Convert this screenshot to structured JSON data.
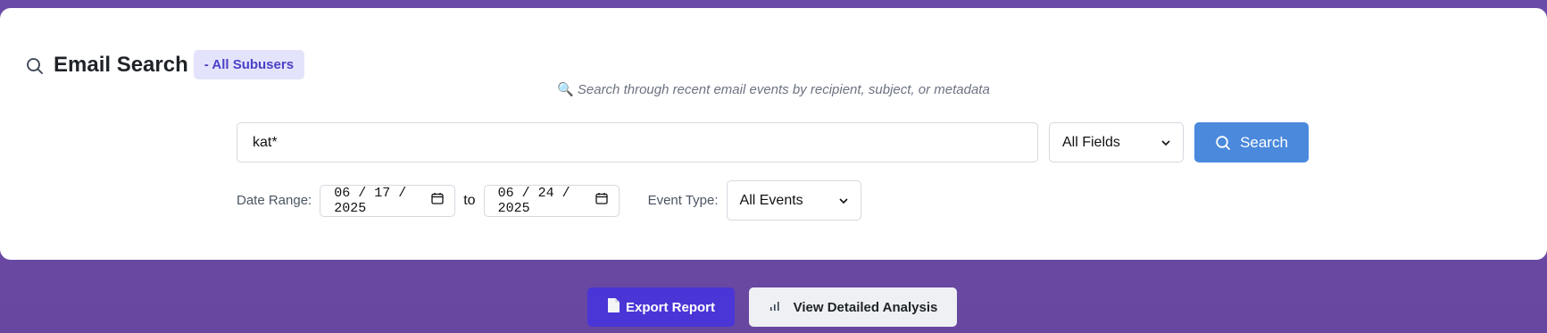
{
  "header": {
    "title": "Email Search",
    "badge": "- All Subusers",
    "subtitle": "Search through recent email events by recipient, subject, or metadata"
  },
  "search": {
    "query": "kat*",
    "field_selected": "All Fields",
    "button_label": "Search"
  },
  "filters": {
    "date_range_label": "Date Range:",
    "date_from": "06 / 17 / 2025",
    "to_label": "to",
    "date_to": "06 / 24 / 2025",
    "event_type_label": "Event Type:",
    "event_type_selected": "All Events"
  },
  "actions": {
    "export_label": "Export Report",
    "analysis_label": "View Detailed Analysis"
  },
  "colors": {
    "background": "#6a4aa3",
    "badge_bg": "#e3e4fb",
    "badge_text": "#4b3fc7",
    "search_button": "#4a89dc",
    "export_button": "#4a36d6"
  },
  "icons": {
    "header": "search-icon",
    "subtitle": "magnifier-icon",
    "search_button": "search-icon",
    "date": "calendar-icon",
    "export": "document-icon",
    "analysis": "bar-chart-icon",
    "select": "chevron-down-icon"
  }
}
